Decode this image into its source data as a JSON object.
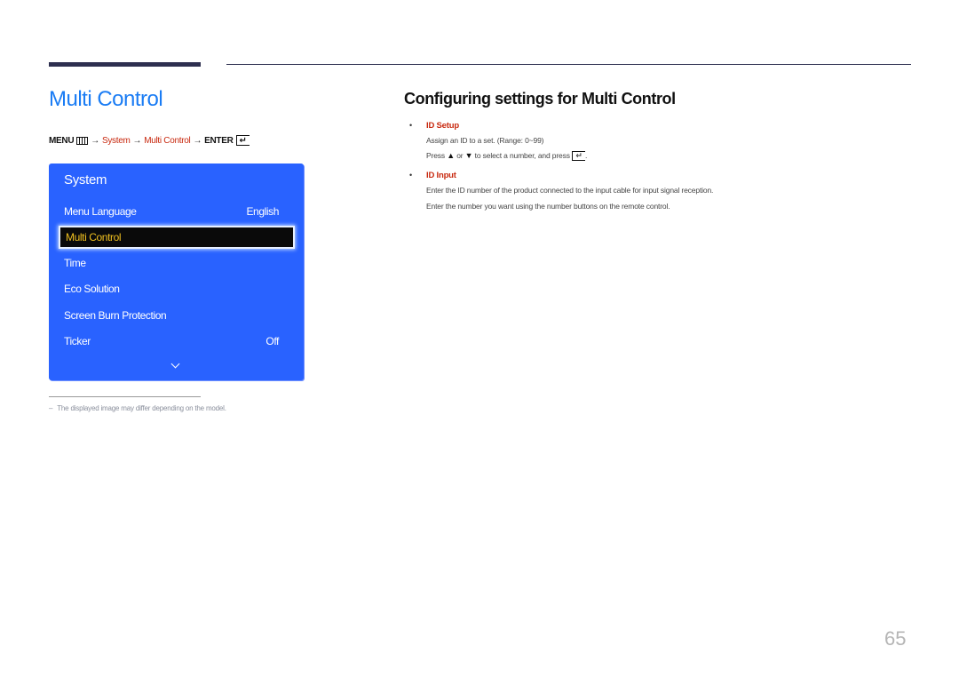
{
  "page": {
    "title": "Multi Control",
    "page_number": "65"
  },
  "breadcrumb": {
    "menu_label": "MENU",
    "menu_icon": "menu-grid-icon",
    "arrow": "→",
    "system": "System",
    "multi_control": "Multi Control",
    "enter_label": "ENTER",
    "enter_icon": "enter-return-icon"
  },
  "osd_panel": {
    "title": "System",
    "items": [
      {
        "label": "Menu Language",
        "value": "English",
        "selected": false
      },
      {
        "label": "Multi Control",
        "value": "",
        "selected": true
      },
      {
        "label": "Time",
        "value": "",
        "selected": false
      },
      {
        "label": "Eco Solution",
        "value": "",
        "selected": false
      },
      {
        "label": "Screen Burn Protection",
        "value": "",
        "selected": false
      },
      {
        "label": "Ticker",
        "value": "Off",
        "selected": false
      }
    ],
    "more_icon": "chevron-down-icon",
    "colors": {
      "background": "#2962ff",
      "selected_text": "#f0c020",
      "selected_bg": "#0a0a0a"
    }
  },
  "footnote": {
    "dash": "–",
    "text": "The displayed image may differ depending on the model."
  },
  "section": {
    "title": "Configuring settings for Multi Control",
    "bullets": [
      {
        "label": "ID Setup",
        "lines": [
          "Assign an ID to a set. (Range: 0~99)",
          {
            "press": "Press",
            "up": "▲",
            "or": "or",
            "down": "▼",
            "rest": "to select a number, and press",
            "end": "."
          }
        ]
      },
      {
        "label": "ID Input",
        "lines": [
          "Enter the ID number of the product connected to the input cable for input signal reception.",
          "Enter the number you want using the number buttons on the remote control."
        ]
      }
    ]
  },
  "colors": {
    "accent_blue": "#1a7cf4",
    "accent_red": "#c8290f",
    "rule": "#2d2f4f"
  }
}
